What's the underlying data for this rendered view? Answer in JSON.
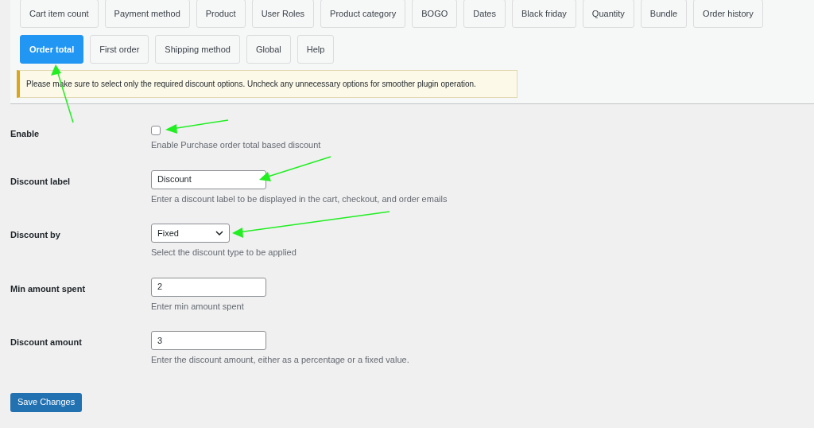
{
  "tabs": [
    {
      "label": "Cart item count",
      "selected": false
    },
    {
      "label": "Payment method",
      "selected": false
    },
    {
      "label": "Product",
      "selected": false
    },
    {
      "label": "User Roles",
      "selected": false
    },
    {
      "label": "Product category",
      "selected": false
    },
    {
      "label": "BOGO",
      "selected": false
    },
    {
      "label": "Dates",
      "selected": false
    },
    {
      "label": "Black friday",
      "selected": false
    },
    {
      "label": "Quantity",
      "selected": false
    },
    {
      "label": "Bundle",
      "selected": false
    },
    {
      "label": "Order history",
      "selected": false
    },
    {
      "label": "Order total",
      "selected": true
    },
    {
      "label": "First order",
      "selected": false
    },
    {
      "label": "Shipping method",
      "selected": false
    },
    {
      "label": "Global",
      "selected": false
    },
    {
      "label": "Help",
      "selected": false
    }
  ],
  "notice": "Please make sure to select only the required discount options. Uncheck any unnecessary options for smoother plugin operation.",
  "fields": [
    {
      "kind": "checkbox",
      "label": "Enable",
      "checked": false,
      "description": "Enable Purchase order total based discount"
    },
    {
      "kind": "text",
      "label": "Discount label",
      "value": "Discount",
      "description": "Enter a discount label to be displayed in the cart, checkout, and order emails"
    },
    {
      "kind": "select",
      "label": "Discount by",
      "value": "Fixed",
      "description": "Select the discount type to be applied"
    },
    {
      "kind": "text",
      "label": "Min amount spent",
      "value": "2",
      "description": "Enter min amount spent"
    },
    {
      "kind": "text",
      "label": "Discount amount",
      "value": "3",
      "description": "Enter the discount amount, either as a percentage or a fixed value."
    }
  ],
  "save_button": "Save Changes"
}
